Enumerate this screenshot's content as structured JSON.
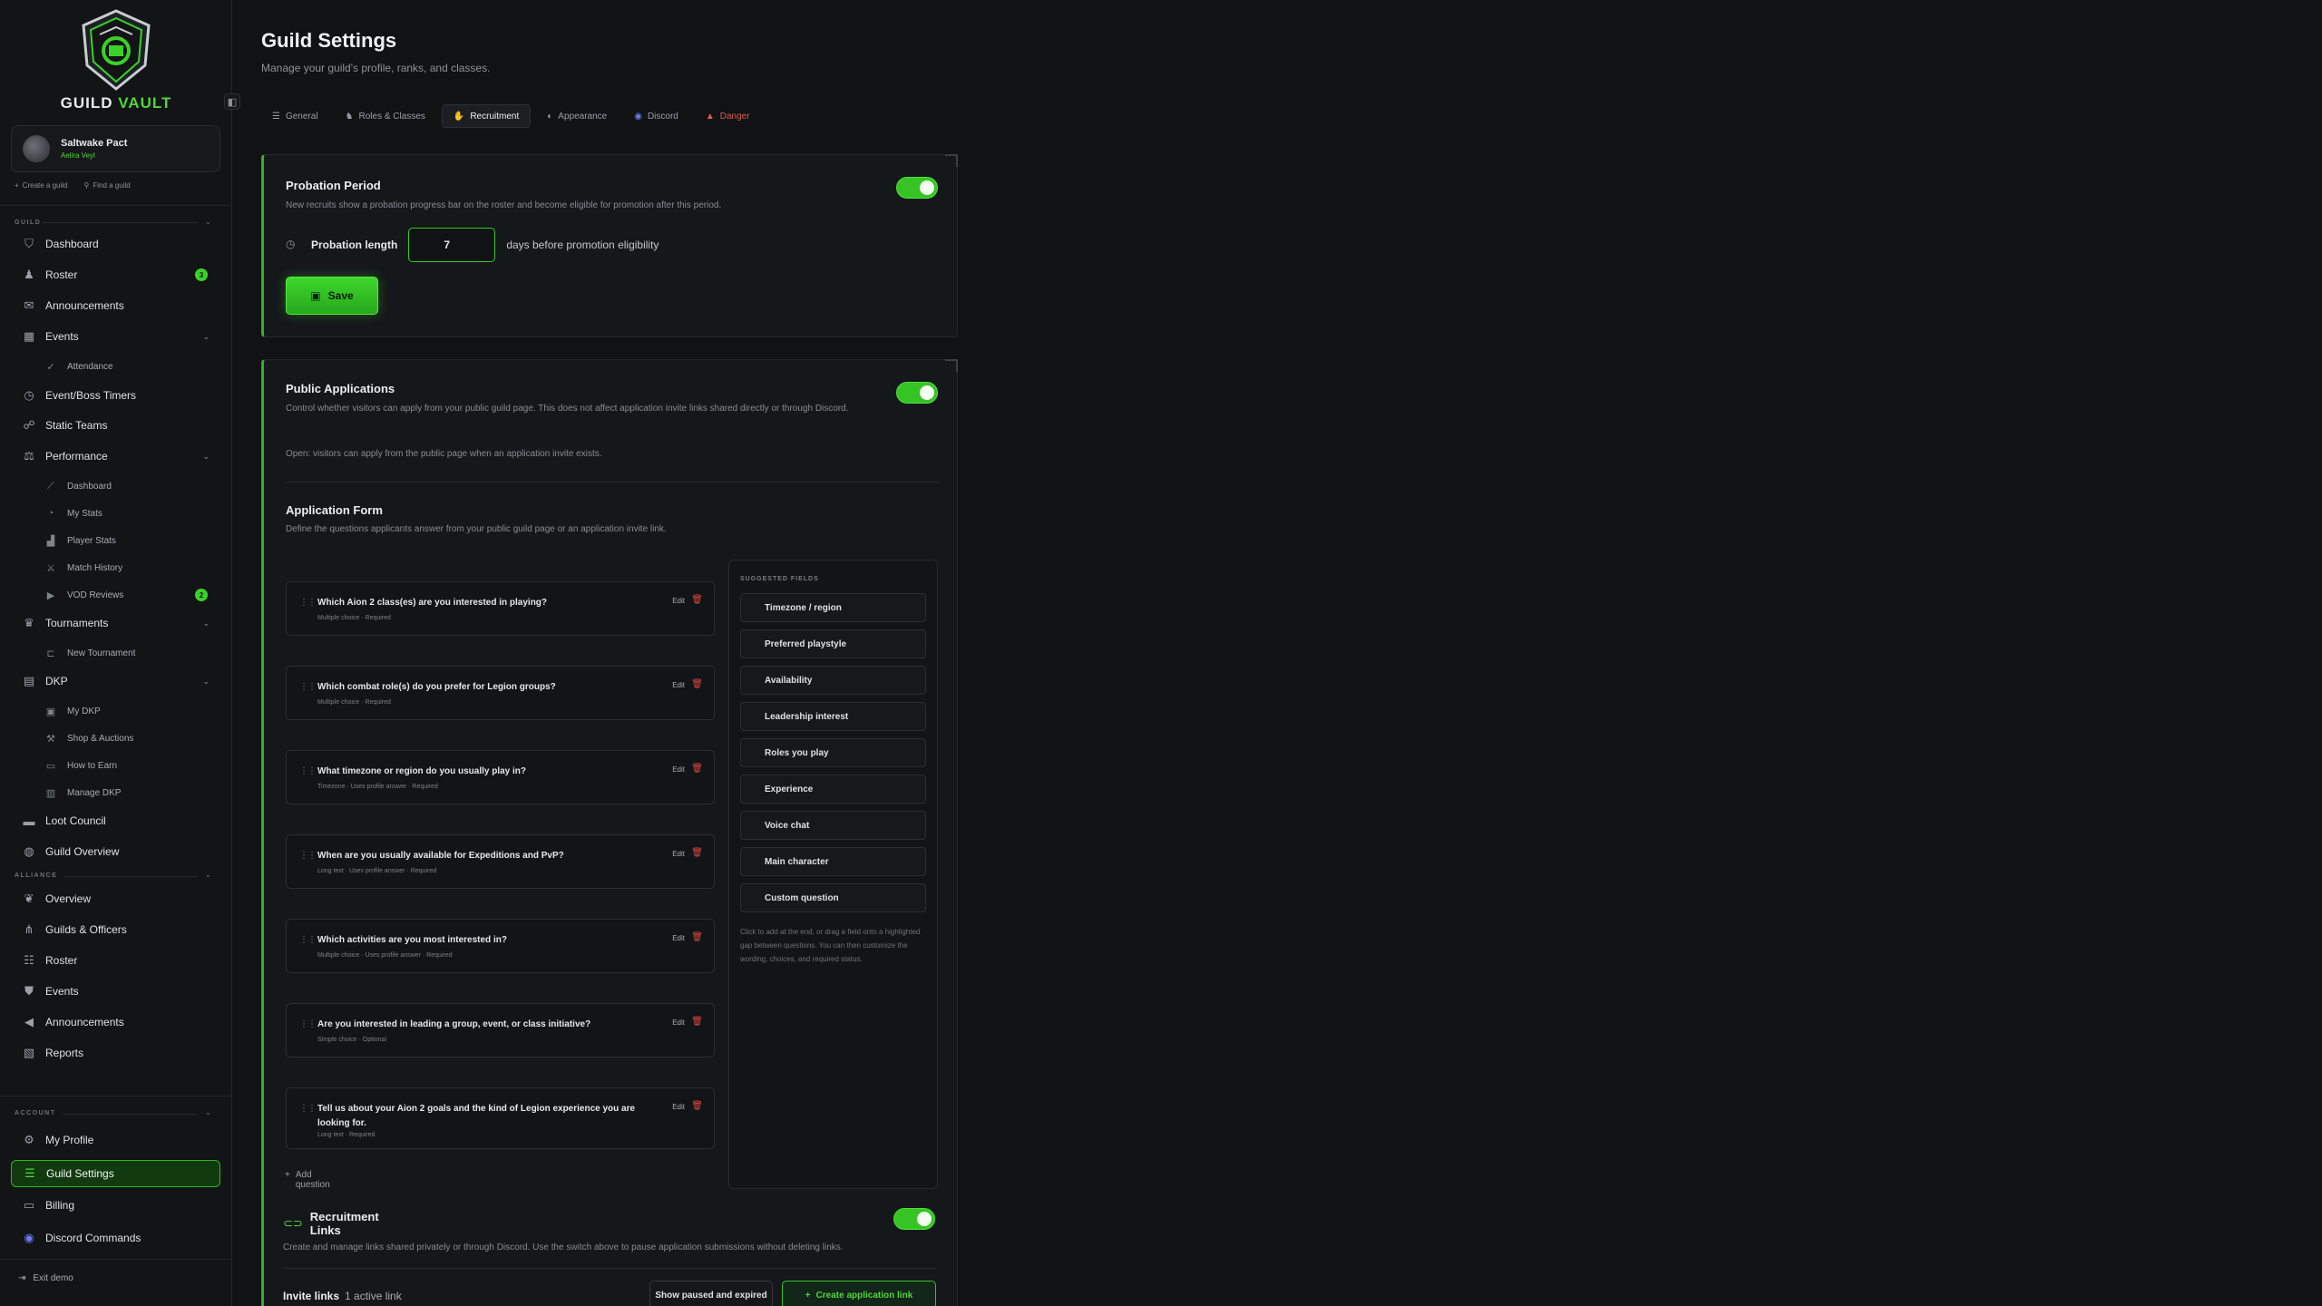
{
  "brand": {
    "name_part1": "GUILD",
    "name_part2": "VAULT",
    "accent": "#3ad12a"
  },
  "guild": {
    "name": "Saltwake Pact",
    "server": "Aelira Veyl",
    "create_label": "Create a guild",
    "find_label": "Find a guild"
  },
  "sidebar": {
    "sections": {
      "guild": "GUILD",
      "alliance": "ALLIANCE",
      "account": "ACCOUNT"
    },
    "guild_items": [
      {
        "label": "Dashboard",
        "icon": "dashboard-icon"
      },
      {
        "label": "Roster",
        "icon": "roster-icon",
        "badge": "3"
      },
      {
        "label": "Announcements",
        "icon": "megaphone-icon"
      },
      {
        "label": "Events",
        "icon": "calendar-icon"
      },
      {
        "label": "Event/Boss Timers",
        "icon": "timer-icon"
      },
      {
        "label": "Static Teams",
        "icon": "team-icon"
      },
      {
        "label": "Performance",
        "icon": "scales-icon"
      },
      {
        "label": "Tournaments",
        "icon": "trophy-icon"
      },
      {
        "label": "DKP",
        "icon": "dkp-icon"
      },
      {
        "label": "Loot Council",
        "icon": "chest-icon"
      },
      {
        "label": "Guild Overview",
        "icon": "globe-icon"
      }
    ],
    "events_sub": [
      {
        "label": "Attendance"
      }
    ],
    "performance_sub": [
      {
        "label": "Dashboard"
      },
      {
        "label": "My Stats"
      },
      {
        "label": "Player Stats"
      },
      {
        "label": "Match History"
      },
      {
        "label": "VOD Reviews",
        "badge": "2"
      }
    ],
    "tournaments_sub": [
      {
        "label": "New Tournament"
      }
    ],
    "dkp_sub": [
      {
        "label": "My DKP"
      },
      {
        "label": "Shop & Auctions"
      },
      {
        "label": "How to Earn"
      },
      {
        "label": "Manage DKP"
      }
    ],
    "alliance_items": [
      {
        "label": "Overview"
      },
      {
        "label": "Guilds & Officers"
      },
      {
        "label": "Roster"
      },
      {
        "label": "Events"
      },
      {
        "label": "Announcements"
      },
      {
        "label": "Reports"
      }
    ],
    "account_items": [
      {
        "label": "My Profile"
      },
      {
        "label": "Guild Settings"
      },
      {
        "label": "Billing"
      },
      {
        "label": "Discord Commands"
      }
    ],
    "exit_label": "Exit demo"
  },
  "page": {
    "title": "Guild Settings",
    "subtitle": "Manage your guild's profile, ranks, and classes."
  },
  "tabs": [
    {
      "label": "General"
    },
    {
      "label": "Roles & Classes"
    },
    {
      "label": "Recruitment"
    },
    {
      "label": "Appearance"
    },
    {
      "label": "Discord"
    },
    {
      "label": "Danger"
    }
  ],
  "probation": {
    "title": "Probation Period",
    "desc": "New recruits show a probation progress bar on the roster and become eligible for promotion after this period.",
    "length_label": "Probation length",
    "length_value": "7",
    "after_label": "days before promotion eligibility",
    "save_label": "Save",
    "enabled": true
  },
  "public_apps": {
    "title": "Public Applications",
    "desc": "Control whether visitors can apply from your public guild page. This does not affect application invite links shared directly or through Discord.",
    "status": "Open: visitors can apply from the public page when an application invite exists.",
    "enabled": true
  },
  "app_form": {
    "title": "Application Form",
    "desc": "Define the questions applicants answer from your public guild page or an application invite link.",
    "edit_label": "Edit",
    "questions": [
      {
        "text": "Which Aion 2 class(es) are you interested in playing?",
        "meta": "Multiple choice · Required"
      },
      {
        "text": "Which combat role(s) do you prefer for Legion groups?",
        "meta": "Multiple choice · Required"
      },
      {
        "text": "What timezone or region do you usually play in?",
        "meta": "Timezone · Uses profile answer · Required"
      },
      {
        "text": "When are you usually available for Expeditions and PvP?",
        "meta": "Long text · Uses profile answer · Required"
      },
      {
        "text": "Which activities are you most interested in?",
        "meta": "Multiple choice · Uses profile answer · Required"
      },
      {
        "text": "Are you interested in leading a group, event, or class initiative?",
        "meta": "Simple choice · Optional"
      },
      {
        "text": "Tell us about your Aion 2 goals and the kind of Legion experience you are looking for.",
        "meta": "Long text · Required"
      }
    ],
    "add_label": "Add question"
  },
  "suggested": {
    "title": "SUGGESTED FIELDS",
    "fields": [
      "Timezone / region",
      "Preferred playstyle",
      "Availability",
      "Leadership interest",
      "Roles you play",
      "Experience",
      "Voice chat",
      "Main character",
      "Custom question"
    ],
    "hint": "Click to add at the end, or drag a field onto a highlighted gap between questions. You can then customize the wording, choices, and required status."
  },
  "recruit_links": {
    "title": "Recruitment Links",
    "desc": "Create and manage links shared privately or through Discord. Use the switch above to pause application submissions without deleting links.",
    "invite_title": "Invite links",
    "active_count": "1 active link",
    "show_paused_label": "Show paused and expired",
    "create_label": "Create application link",
    "enabled": true
  }
}
